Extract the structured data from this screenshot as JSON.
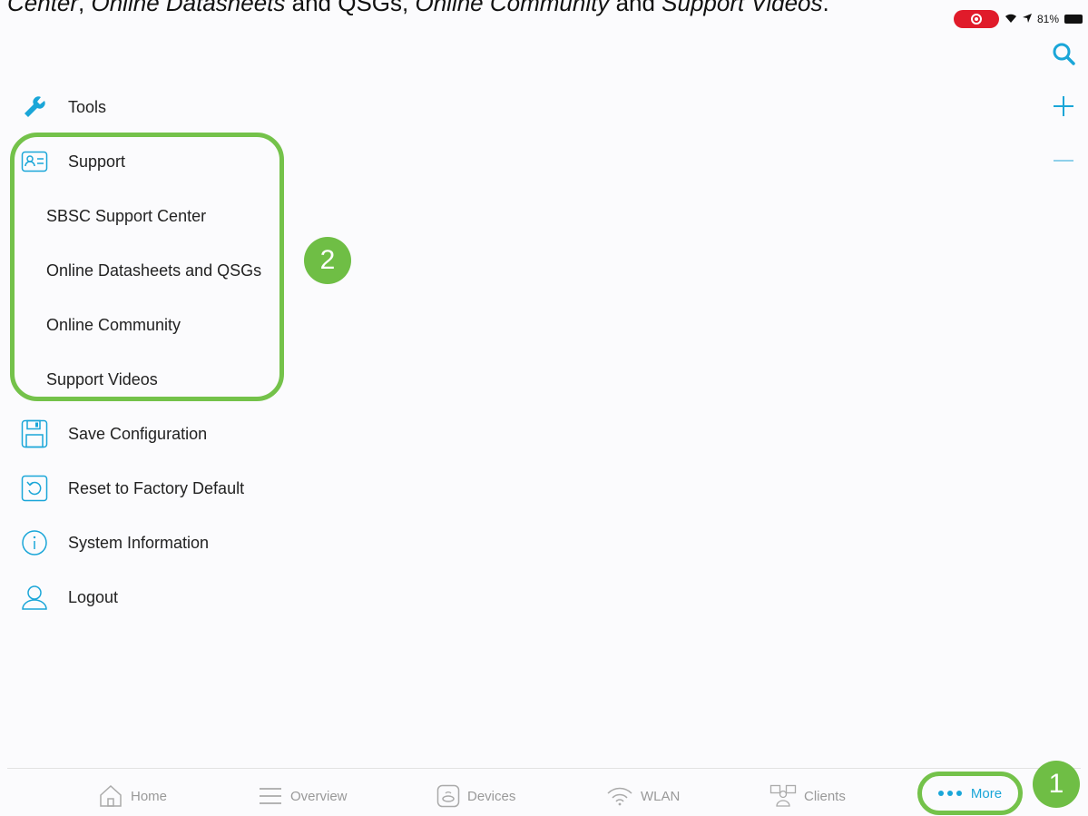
{
  "caption": {
    "part1": "Center",
    "sep1": ", ",
    "part2": "Online Datasheets",
    "sep2": " and QSGs, ",
    "part3": "Online Community",
    "sep3": " and ",
    "part4": "Support Videos",
    "end": "."
  },
  "status": {
    "battery": "81%"
  },
  "menu": {
    "tools": "Tools",
    "support": "Support",
    "sbsc": "SBSC Support Center",
    "datasheets": "Online Datasheets and QSGs",
    "community": "Online Community",
    "videos": "Support Videos",
    "save": "Save Configuration",
    "reset": "Reset to Factory Default",
    "sysinfo": "System Information",
    "logout": "Logout"
  },
  "badges": {
    "one": "1",
    "two": "2"
  },
  "tabs": {
    "home": "Home",
    "overview": "Overview",
    "devices": "Devices",
    "wlan": "WLAN",
    "clients": "Clients",
    "more": "More"
  },
  "colors": {
    "accent": "#1aa6d8",
    "highlight": "#74c24a",
    "record": "#e01b2a"
  }
}
